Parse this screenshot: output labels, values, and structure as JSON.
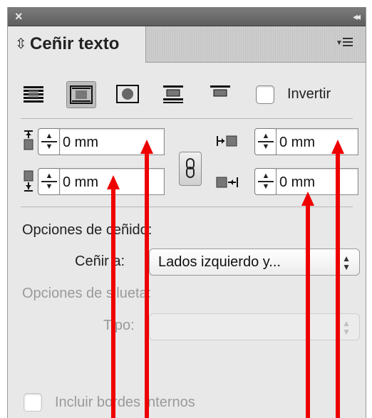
{
  "titlebar": {
    "close_glyph": "×",
    "collapse_glyph": "◂◂"
  },
  "tab": {
    "arrows_glyph": "⇳",
    "title": "Ceñir texto"
  },
  "wrap_buttons": [
    {
      "icon": "no-wrap-icon",
      "selected": false
    },
    {
      "icon": "wrap-bounding-box-icon",
      "selected": true
    },
    {
      "icon": "wrap-object-shape-icon",
      "selected": false
    },
    {
      "icon": "jump-object-icon",
      "selected": false
    },
    {
      "icon": "jump-next-column-icon",
      "selected": false
    }
  ],
  "invert": {
    "label": "Invertir",
    "checked": false
  },
  "offsets": {
    "top": "0 mm",
    "bottom": "0 mm",
    "left": "0 mm",
    "right": "0 mm"
  },
  "wrap_options": {
    "heading": "Opciones de ceñido:",
    "wrap_to_label": "Ceñir a:",
    "wrap_to_value": "Lados izquierdo y..."
  },
  "contour_options": {
    "heading": "Opciones de silueta:",
    "type_label": "Tipo:",
    "type_value": ""
  },
  "include_inside_edges": {
    "label": "Incluir bordes internos",
    "checked": false
  },
  "colors": {
    "annotation_arrow": "#ee0000"
  }
}
